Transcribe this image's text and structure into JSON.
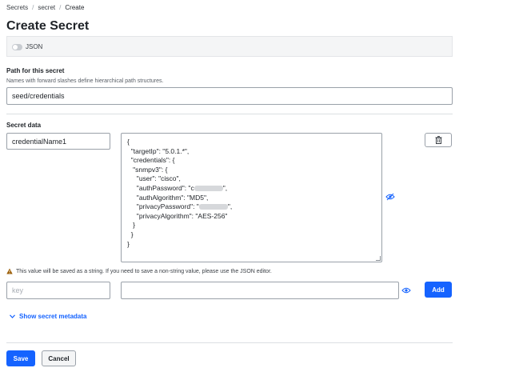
{
  "breadcrumb": {
    "items": [
      "Secrets",
      "secret",
      "Create"
    ],
    "separator": "/"
  },
  "page_title": "Create Secret",
  "toolbar": {
    "json_toggle_label": "JSON",
    "json_toggle_on": false
  },
  "path": {
    "label": "Path for this secret",
    "help": "Names with forward slashes define hierarchical path structures.",
    "value": "seed/credentials"
  },
  "secret_data": {
    "label": "Secret data",
    "row1": {
      "key": "credentialName1",
      "value_lines": [
        {
          "text": "{"
        },
        {
          "text": "  \"targetIp\": \"5.0.1.*\","
        },
        {
          "text": "  \"credentials\": {"
        },
        {
          "text": "   \"snmpv3\": {"
        },
        {
          "text": "     \"user\": \"cisco\","
        },
        {
          "prefix": "     \"authPassword\": \"c",
          "masked": true,
          "suffix": "\","
        },
        {
          "text": "     \"authAlgorithm\": \"MD5\","
        },
        {
          "prefix": "     \"privacyPassword\": \"",
          "masked": true,
          "suffix": "\","
        },
        {
          "text": "     \"privacyAlgorithm\": \"AES-256\""
        },
        {
          "text": "   }"
        },
        {
          "text": "  }"
        },
        {
          "text": "}"
        }
      ]
    },
    "warning": "This value will be saved as a string. If you need to save a non-string value, please use the JSON editor.",
    "new_row": {
      "key_placeholder": "key",
      "value": "",
      "add_label": "Add"
    }
  },
  "metadata_link": "Show secret metadata",
  "actions": {
    "save": "Save",
    "cancel": "Cancel"
  },
  "colors": {
    "primary": "#1563ff",
    "warning": "#9a5b00",
    "border": "#9aa1a9"
  },
  "icons": [
    "delete-icon",
    "reveal-eye-icon",
    "warning-icon",
    "chevron-down-icon"
  ]
}
